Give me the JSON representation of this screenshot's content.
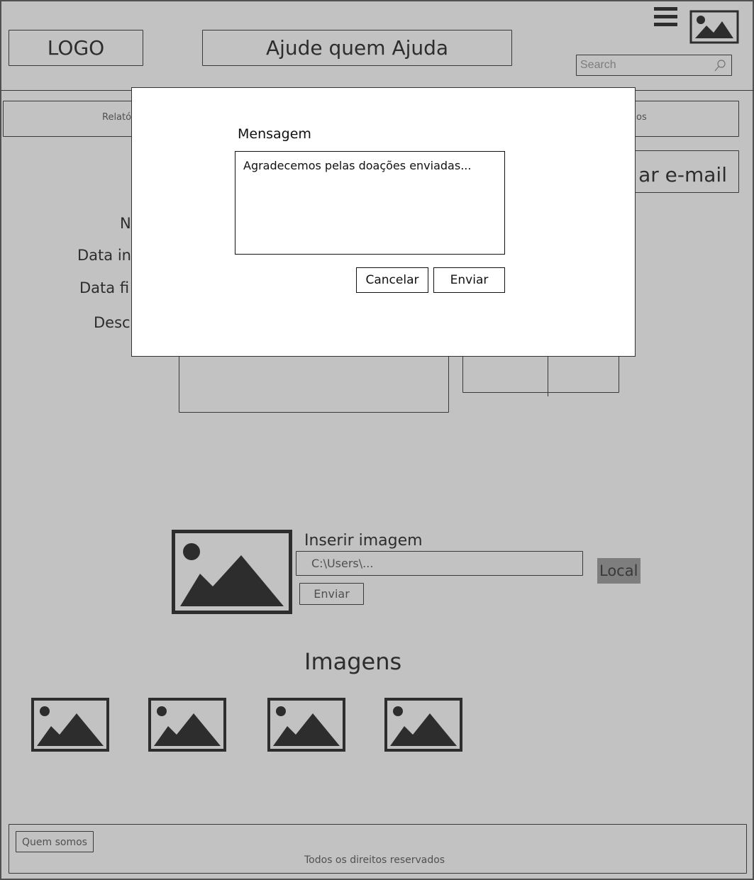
{
  "header": {
    "logo": "LOGO",
    "title": "Ajude quem Ajuda",
    "search_placeholder": "Search",
    "menu_icon": "hamburger-menu-icon",
    "avatar_icon": "image-placeholder-icon"
  },
  "tabs": {
    "left_label": "Relató",
    "right_label": "os"
  },
  "email_button": {
    "label": "ar e-mail"
  },
  "form_labels": {
    "name": "N",
    "start_date": "Data in",
    "end_date": "Data fi",
    "description": "Desc"
  },
  "upload": {
    "label": "Inserir imagem",
    "path_value": "C:\\Users\\...",
    "local_button": "Local",
    "send_button": "Enviar"
  },
  "gallery": {
    "title": "Imagens"
  },
  "footer": {
    "about_button": "Quem somos",
    "rights": "Todos os direitos reservados"
  },
  "modal": {
    "title": "Mensagem",
    "message": "Agradecemos pelas doações enviadas...",
    "cancel_label": "Cancelar",
    "send_label": "Enviar"
  },
  "colors": {
    "overlay": "#c4c4c4",
    "modal_bg": "#ffffff"
  }
}
